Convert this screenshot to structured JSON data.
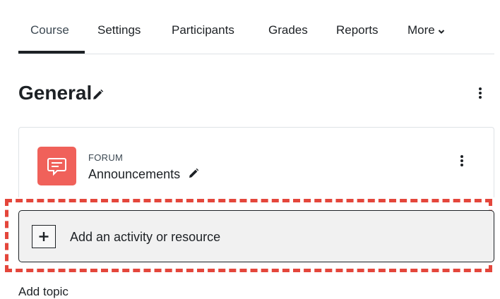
{
  "nav": {
    "tabs": [
      {
        "label": "Course"
      },
      {
        "label": "Settings"
      },
      {
        "label": "Participants"
      },
      {
        "label": "Grades"
      },
      {
        "label": "Reports"
      },
      {
        "label": "More"
      }
    ],
    "active_tab": "Course"
  },
  "section": {
    "title": "General"
  },
  "activity": {
    "type": "FORUM",
    "name": "Announcements",
    "icon": "forum-icon",
    "icon_color": "#f0615a"
  },
  "add_activity": {
    "label": "Add an activity or resource",
    "highlight_color": "#e4463b"
  },
  "add_topic": {
    "label": "Add topic"
  }
}
